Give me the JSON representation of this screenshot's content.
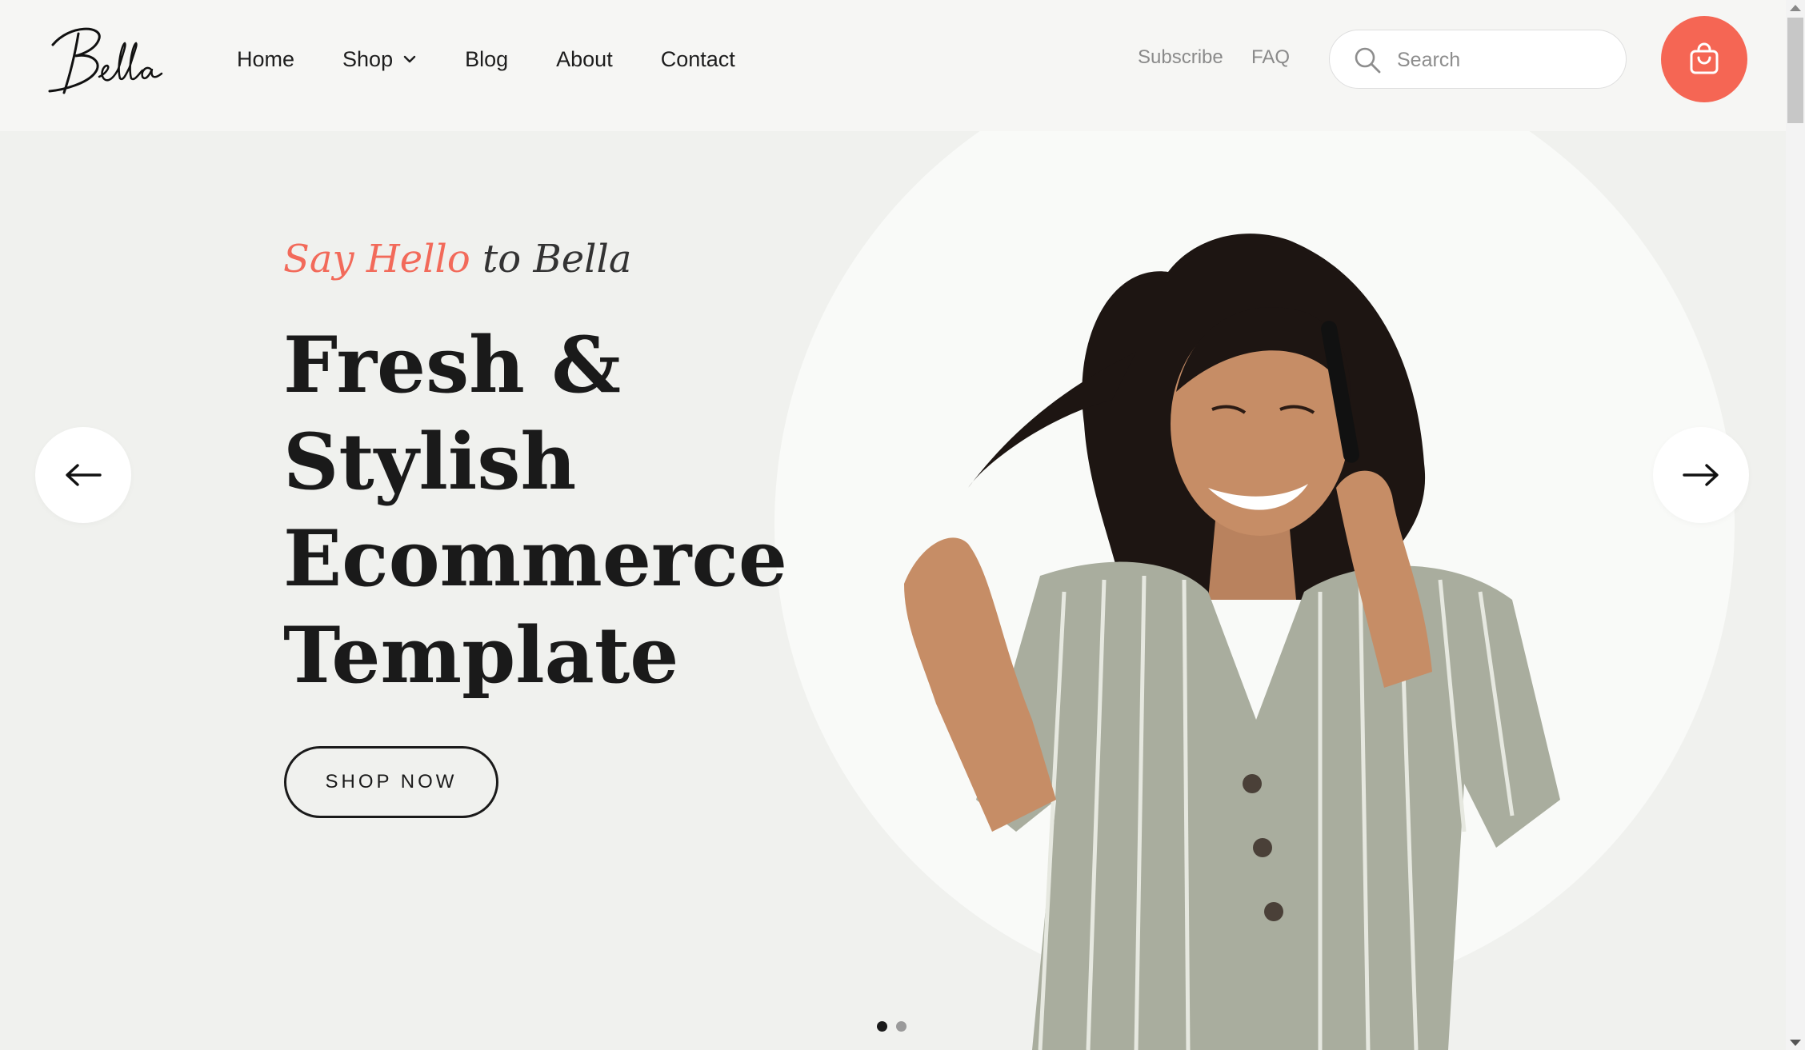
{
  "brand": {
    "logo_text": "Bella"
  },
  "nav": {
    "items": [
      {
        "label": "Home"
      },
      {
        "label": "Shop"
      },
      {
        "label": "Blog"
      },
      {
        "label": "About"
      },
      {
        "label": "Contact"
      }
    ]
  },
  "utility": {
    "subscribe": "Subscribe",
    "faq": "FAQ"
  },
  "search": {
    "placeholder": "Search",
    "value": ""
  },
  "hero": {
    "tagline_accent": "Say Hello",
    "tagline_rest": "to Bella",
    "headline": [
      "Fresh &",
      "Stylish",
      "Ecommerce",
      "Template"
    ],
    "cta_label": "SHOP NOW"
  },
  "slider": {
    "slide_count": 2,
    "active_index": 0
  },
  "colors": {
    "accent": "#f56654",
    "background": "#f0f1ee",
    "text": "#1a1a1a",
    "shirt": "#a9ad9e"
  },
  "icons": {
    "search": "search-icon",
    "cart": "shopping-bag-icon",
    "prev": "arrow-left-icon",
    "next": "arrow-right-icon",
    "dropdown": "chevron-down-icon"
  }
}
